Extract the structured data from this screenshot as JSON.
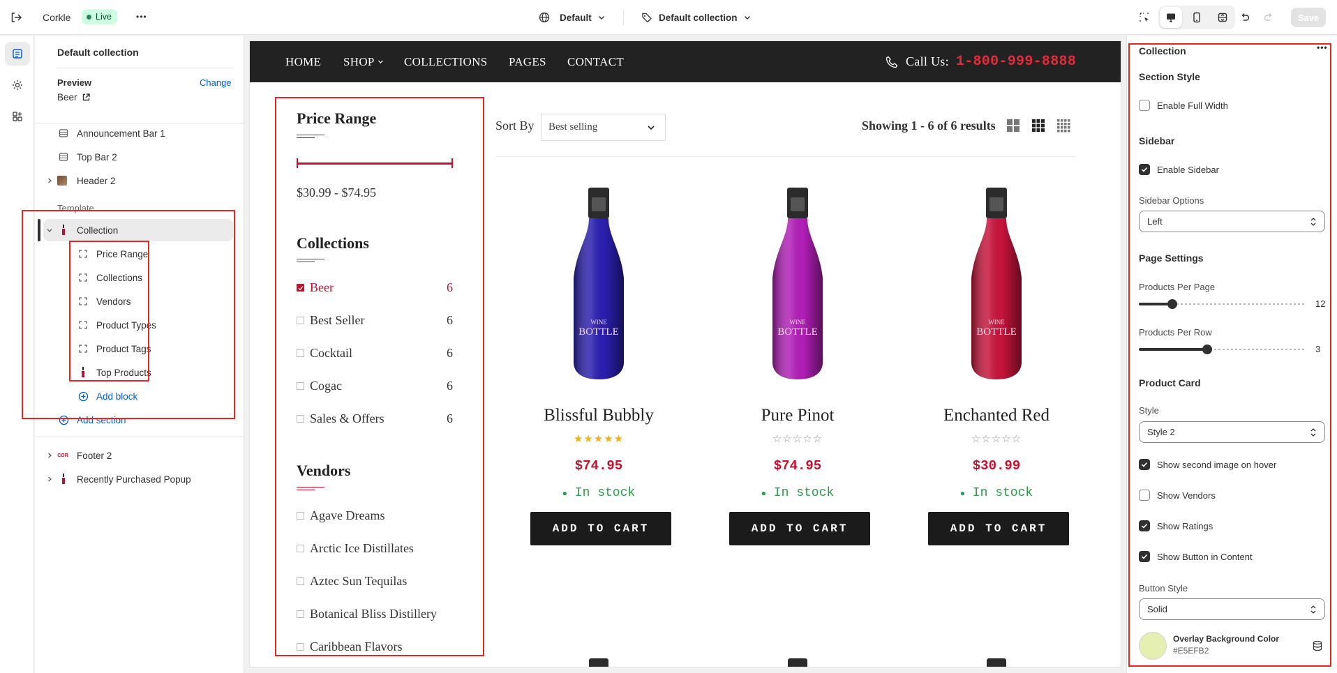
{
  "topbar": {
    "store_name": "Corkle",
    "status_badge": "Live",
    "more_label": "•••",
    "theme_selector": "Default",
    "template_selector": "Default collection",
    "save_label": "Save"
  },
  "left_panel": {
    "title": "Default collection",
    "preview_label": "Preview",
    "preview_change": "Change",
    "preview_value": "Beer",
    "header_sections": [
      "Announcement Bar 1",
      "Top Bar 2",
      "Header 2"
    ],
    "template_label": "Template",
    "template_section": "Collection",
    "blocks": [
      "Price Range",
      "Collections",
      "Vendors",
      "Product Types",
      "Product Tags",
      "Top Products"
    ],
    "add_block": "Add block",
    "add_section": "Add section",
    "footer_sections": [
      "Footer 2",
      "Recently Purchased Popup"
    ]
  },
  "store_nav": {
    "links": [
      "HOME",
      "SHOP",
      "COLLECTIONS",
      "PAGES",
      "CONTACT"
    ],
    "call_label": "Call Us:",
    "phone": "1-800-999-8888"
  },
  "filters": {
    "price_title": "Price Range",
    "price_value": "$30.99 - $74.95",
    "collections_title": "Collections",
    "collections": [
      {
        "name": "Beer",
        "count": "6",
        "checked": true
      },
      {
        "name": "Best Seller",
        "count": "6",
        "checked": false
      },
      {
        "name": "Cocktail",
        "count": "6",
        "checked": false
      },
      {
        "name": "Cogac",
        "count": "6",
        "checked": false
      },
      {
        "name": "Sales & Offers",
        "count": "6",
        "checked": false
      }
    ],
    "vendors_title": "Vendors",
    "vendors": [
      "Agave Dreams",
      "Arctic Ice Distillates",
      "Aztec Sun Tequilas",
      "Botanical Bliss Distillery",
      "Caribbean Flavors"
    ]
  },
  "toolbar": {
    "sort_label": "Sort By",
    "sort_value": "Best selling",
    "results": "Showing 1 - 6 of 6 results"
  },
  "products": [
    {
      "name": "Blissful Bubbly",
      "price": "$74.95",
      "stock": "In stock",
      "rating": 5,
      "button": "ADD TO CART",
      "bottle_color": "#2a1fb0",
      "label_top": "WINE",
      "label_main": "BOTTLE"
    },
    {
      "name": "Pure Pinot",
      "price": "$74.95",
      "stock": "In stock",
      "rating": 0,
      "button": "ADD TO CART",
      "bottle_color": "#b21fb8",
      "label_top": "WINE",
      "label_main": "BOTTLE"
    },
    {
      "name": "Enchanted Red",
      "price": "$30.99",
      "stock": "In stock",
      "rating": 0,
      "button": "ADD TO CART",
      "bottle_color": "#c8143c",
      "label_top": "WINE",
      "label_main": "BOTTLE"
    }
  ],
  "right_panel": {
    "title": "Collection",
    "section_style": "Section Style",
    "enable_full_width": "Enable Full Width",
    "sidebar": "Sidebar",
    "enable_sidebar": "Enable Sidebar",
    "sidebar_options_label": "Sidebar Options",
    "sidebar_options_value": "Left",
    "page_settings": "Page Settings",
    "per_page_label": "Products Per Page",
    "per_page_value": "12",
    "per_page_fraction": 0.2,
    "per_row_label": "Products Per Row",
    "per_row_value": "3",
    "per_row_fraction": 0.41,
    "product_card": "Product Card",
    "style_label": "Style",
    "style_value": "Style 2",
    "show_second_image": "Show second image on hover",
    "show_vendors": "Show Vendors",
    "show_ratings": "Show Ratings",
    "show_button": "Show Button in Content",
    "button_style_label": "Button Style",
    "button_style_value": "Solid",
    "overlay_label": "Overlay Background Color",
    "overlay_value": "#E5EFB2"
  },
  "colors": {
    "accent_red": "#c8102e",
    "in_stock_green": "#2a9d4a",
    "annotation_red": "#e8251f",
    "overlay_swatch": "#E5EFB2"
  }
}
